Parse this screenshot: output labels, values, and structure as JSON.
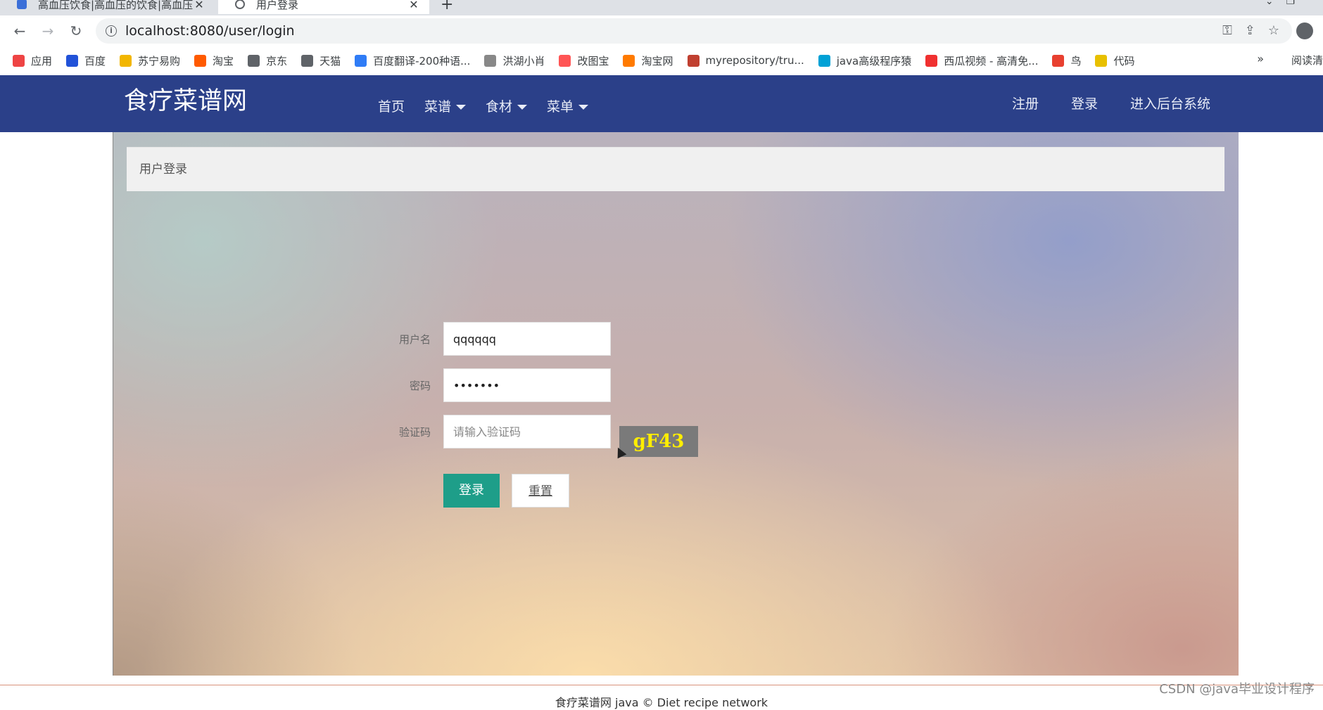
{
  "browser": {
    "tabs": [
      {
        "title": "高血压饮食|高血压的饮食|高血压",
        "active": false
      },
      {
        "title": "用户登录",
        "active": true
      }
    ],
    "address": "localhost:8080/user/login",
    "bookmarks": [
      {
        "label": "应用",
        "color": "#e44"
      },
      {
        "label": "百度",
        "color": "#2152d8"
      },
      {
        "label": "苏宁易购",
        "color": "#f2b600"
      },
      {
        "label": "淘宝",
        "color": "#ff5a00"
      },
      {
        "label": "京东",
        "color": "#5f6368"
      },
      {
        "label": "天猫",
        "color": "#5f6368"
      },
      {
        "label": "百度翻译-200种语...",
        "color": "#2f7cf6"
      },
      {
        "label": "洪湖小肖",
        "color": "#888"
      },
      {
        "label": "改图宝",
        "color": "#f55"
      },
      {
        "label": "淘宝网",
        "color": "#ff7a00"
      },
      {
        "label": "myrepository/tru...",
        "color": "#c04030"
      },
      {
        "label": "java高级程序猿",
        "color": "#00a1d6"
      },
      {
        "label": "西瓜视频 - 高清免...",
        "color": "#f03030"
      },
      {
        "label": "鸟",
        "color": "#e84030"
      },
      {
        "label": "代码",
        "color": "#e8c000"
      }
    ],
    "more": "»",
    "reading_list": "阅读清"
  },
  "site": {
    "brand": "食疗菜谱网",
    "nav": [
      {
        "label": "首页",
        "dropdown": false
      },
      {
        "label": "菜谱",
        "dropdown": true
      },
      {
        "label": "食材",
        "dropdown": true
      },
      {
        "label": "菜单",
        "dropdown": true
      }
    ],
    "nav_right": [
      "注册",
      "登录",
      "进入后台系统"
    ]
  },
  "login": {
    "panel_title": "用户登录",
    "username_label": "用户名",
    "username_value": "qqqqqq",
    "password_label": "密码",
    "password_value": "•••••••",
    "captcha_label": "验证码",
    "captcha_placeholder": "请输入验证码",
    "captcha_code": "gF43",
    "login_button": "登录",
    "reset_button": "重置"
  },
  "footer": {
    "text": "食疗菜谱网 java © Diet recipe network",
    "watermark": "CSDN @java毕业设计程序"
  },
  "colors": {
    "header_bg": "#2b4089",
    "login_button": "#1e9e89",
    "captcha_bg": "#7a7a7a",
    "captcha_text": "#ffee00"
  }
}
